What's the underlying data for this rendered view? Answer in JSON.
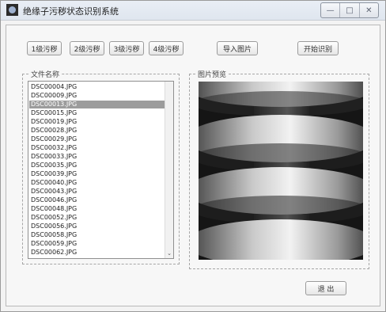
{
  "window": {
    "title": "绝缘子污秽状态识别系统"
  },
  "toolbar": {
    "buttons": [
      {
        "label": "1级污秽"
      },
      {
        "label": "2级污秽"
      },
      {
        "label": "3级污秽"
      },
      {
        "label": "4级污秽"
      },
      {
        "label": "导入图片"
      },
      {
        "label": "开始识别"
      }
    ]
  },
  "file_list": {
    "label": "文件名称",
    "selected_index": 2,
    "items": [
      "DSC00004.JPG",
      "DSC00009.JPG",
      "DSC00013.JPG",
      "DSC00015.JPG",
      "DSC00019.JPG",
      "DSC00028.JPG",
      "DSC00029.JPG",
      "DSC00032.JPG",
      "DSC00033.JPG",
      "DSC00035.JPG",
      "DSC00039.JPG",
      "DSC00040.JPG",
      "DSC00043.JPG",
      "DSC00046.JPG",
      "DSC00048.JPG",
      "DSC00052.JPG",
      "DSC00056.JPG",
      "DSC00058.JPG",
      "DSC00059.JPG",
      "DSC00062.JPG"
    ]
  },
  "preview": {
    "label": "图片预览"
  },
  "footer": {
    "exit_label": "退 出"
  }
}
